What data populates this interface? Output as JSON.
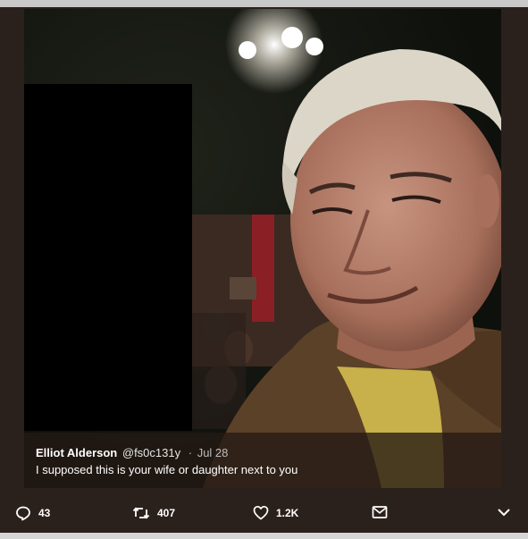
{
  "tweet": {
    "author_name": "Elliot Alderson",
    "author_handle": "@fs0c131y",
    "separator": "·",
    "date": "Jul 28",
    "text": "I supposed this is your wife or daughter next to you"
  },
  "actions": {
    "reply_count": "43",
    "retweet_count": "407",
    "like_count": "1.2K"
  },
  "icons": {
    "reply": "reply-icon",
    "retweet": "retweet-icon",
    "like": "heart-icon",
    "message": "mail-icon",
    "more": "chevron-down-icon"
  },
  "colors": {
    "background": "#2b211c",
    "text": "#ffffff",
    "muted": "#bcbcbc"
  }
}
